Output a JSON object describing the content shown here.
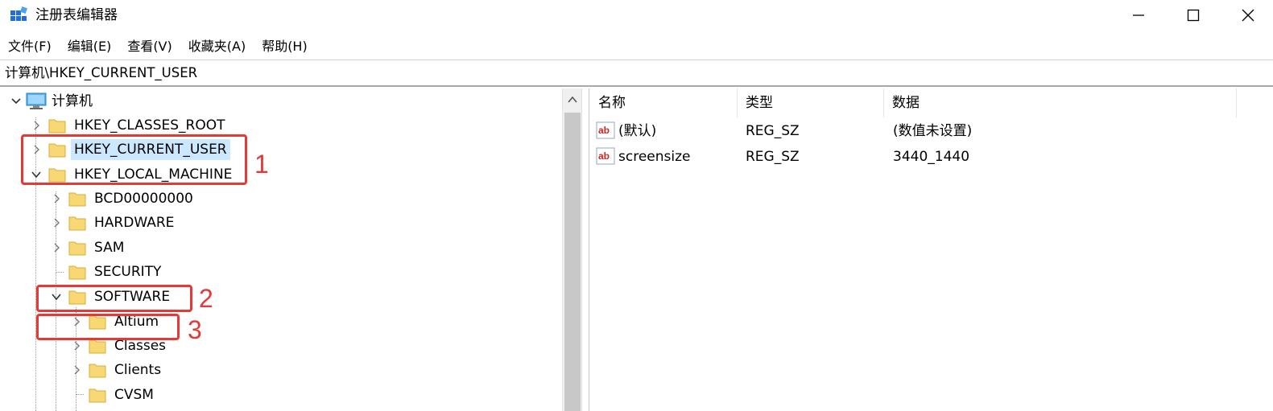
{
  "window": {
    "title": "注册表编辑器",
    "icons": {
      "app": "registry-editor-icon",
      "minimize": "minimize-icon",
      "maximize": "maximize-icon",
      "close": "close-icon"
    }
  },
  "menu": [
    "文件(F)",
    "编辑(E)",
    "查看(V)",
    "收藏夹(A)",
    "帮助(H)"
  ],
  "address": "计算机\\HKEY_CURRENT_USER",
  "tree": {
    "root": "计算机",
    "items": [
      {
        "label": "HKEY_CLASSES_ROOT",
        "level": 1,
        "expander": "collapsed"
      },
      {
        "label": "HKEY_CURRENT_USER",
        "level": 1,
        "expander": "collapsed",
        "selected": true
      },
      {
        "label": "HKEY_LOCAL_MACHINE",
        "level": 1,
        "expander": "expanded"
      },
      {
        "label": "BCD00000000",
        "level": 2,
        "expander": "collapsed"
      },
      {
        "label": "HARDWARE",
        "level": 2,
        "expander": "collapsed"
      },
      {
        "label": "SAM",
        "level": 2,
        "expander": "collapsed"
      },
      {
        "label": "SECURITY",
        "level": 2,
        "expander": "none"
      },
      {
        "label": "SOFTWARE",
        "level": 2,
        "expander": "expanded"
      },
      {
        "label": "Altium",
        "level": 3,
        "expander": "collapsed"
      },
      {
        "label": "Classes",
        "level": 3,
        "expander": "collapsed"
      },
      {
        "label": "Clients",
        "level": 3,
        "expander": "collapsed"
      },
      {
        "label": "CVSM",
        "level": 3,
        "expander": "none"
      }
    ]
  },
  "values": {
    "columns": [
      "名称",
      "类型",
      "数据"
    ],
    "rows": [
      {
        "name": "(默认)",
        "type": "REG_SZ",
        "data": "(数值未设置)",
        "icon": "string-value-icon"
      },
      {
        "name": "screensize",
        "type": "REG_SZ",
        "data": "3440_1440",
        "icon": "string-value-icon"
      }
    ]
  },
  "annotations": {
    "labels": [
      "1",
      "2",
      "3"
    ],
    "color": "#e53935"
  },
  "colors": {
    "selection": "#cce8ff",
    "folder": "#f8d775",
    "accent": "#e53935"
  }
}
